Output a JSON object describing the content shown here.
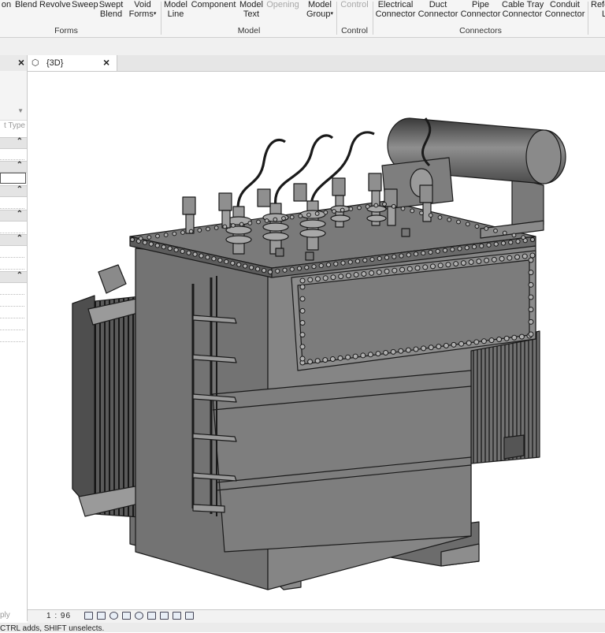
{
  "ribbon": {
    "forms": {
      "title": "Forms",
      "buttons": [
        {
          "line1": "on",
          "line2": ""
        },
        {
          "line1": "Blend",
          "line2": ""
        },
        {
          "line1": "Revolve",
          "line2": ""
        },
        {
          "line1": "Sweep",
          "line2": ""
        },
        {
          "line1": "Swept",
          "line2": "Blend"
        },
        {
          "line1": "Void",
          "line2": "Forms"
        }
      ]
    },
    "model": {
      "title": "Model",
      "buttons": [
        {
          "line1": "Model",
          "line2": "Line"
        },
        {
          "line1": "Component",
          "line2": ""
        },
        {
          "line1": "Model",
          "line2": "Text"
        },
        {
          "line1": "Opening",
          "line2": ""
        },
        {
          "line1": "Model",
          "line2": "Group"
        }
      ]
    },
    "control": {
      "title": "Control",
      "buttons": [
        {
          "line1": "Control",
          "line2": ""
        }
      ]
    },
    "connectors": {
      "title": "Connectors",
      "buttons": [
        {
          "line1": "Electrical",
          "line2": "Connector"
        },
        {
          "line1": "Duct",
          "line2": "Connector"
        },
        {
          "line1": "Pipe",
          "line2": "Connector"
        },
        {
          "line1": "Cable Tray",
          "line2": "Connector"
        },
        {
          "line1": "Conduit",
          "line2": "Connector"
        }
      ]
    },
    "ref": {
      "line1": "Refe",
      "line2": "L"
    },
    "dropdown_caret": "▾"
  },
  "properties_panel": {
    "close": "×",
    "edit_type_label": "t Type",
    "collapse_glyph": "⌃",
    "apply_label": "ply"
  },
  "view_tab": {
    "label": "{3D}",
    "close": "×",
    "icon": "3d-view-icon"
  },
  "view_control_bar": {
    "scale": "1 : 96",
    "icons": [
      "detail-level-icon",
      "visual-style-icon",
      "sun-path-icon",
      "shadows-icon",
      "render-icon",
      "crop-view-icon",
      "show-crop-icon",
      "temporary-hide-icon",
      "reveal-hidden-icon"
    ]
  },
  "status_bar": {
    "text": "CTRL adds, SHIFT unselects."
  },
  "colors": {
    "model_shade": "#7a7a7a",
    "model_edge": "#1a1a1a",
    "ribbon_bg": "#f5f5f5",
    "disabled_text": "#a8a8a8"
  }
}
